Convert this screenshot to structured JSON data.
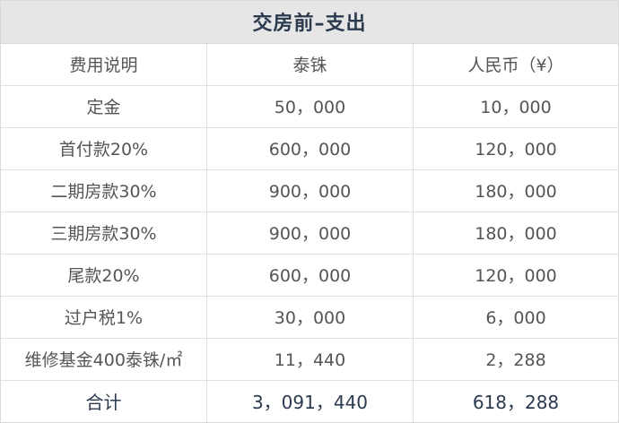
{
  "title": "交房前–支出",
  "headers": [
    "费用说明",
    "泰铢",
    "人民币（¥）"
  ],
  "rows": [
    [
      "定金",
      "50，000",
      "10，000"
    ],
    [
      "首付款20%",
      "600，000",
      "120，000"
    ],
    [
      "二期房款30%",
      "900，000",
      "180，000"
    ],
    [
      "三期房款30%",
      "900，000",
      "180，000"
    ],
    [
      "尾款20%",
      "600，000",
      "120，000"
    ],
    [
      "过户税1%",
      "30，000",
      "6，000"
    ],
    [
      "维修基金400泰铢/㎡",
      "11，440",
      "2，288"
    ]
  ],
  "total": [
    "合计",
    "3，091，440",
    "618，288"
  ]
}
